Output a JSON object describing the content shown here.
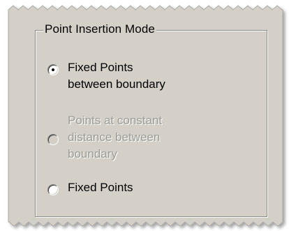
{
  "group": {
    "title": "Point Insertion  Mode"
  },
  "options": [
    {
      "label": "Fixed Points\nbetween boundary",
      "checked": true,
      "enabled": true
    },
    {
      "label": "Points at constant\ndistance between\nboundary",
      "checked": false,
      "enabled": false
    },
    {
      "label": "Fixed Points",
      "checked": false,
      "enabled": true
    }
  ],
  "colors": {
    "panel_bg": "#d4d0c8",
    "disabled_text": "#9b9b96",
    "frame_border": "#8c8c8c"
  }
}
